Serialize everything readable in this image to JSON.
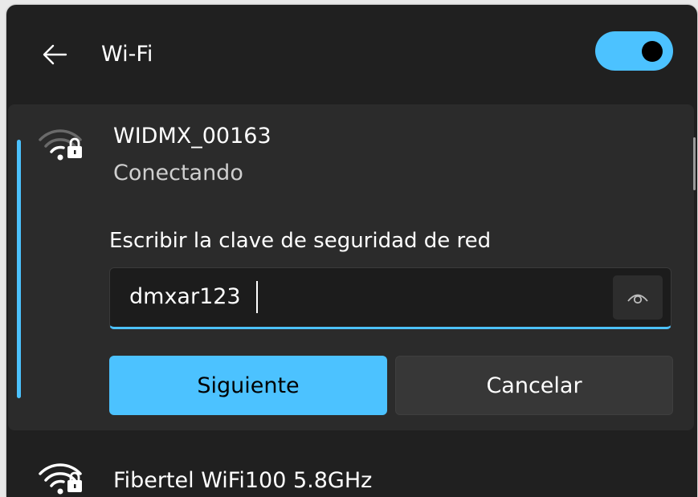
{
  "header": {
    "title": "Wi-Fi",
    "back_icon": "arrow-left-icon",
    "toggle_on": true
  },
  "selected_network": {
    "name": "WIDMX_00163",
    "status": "Conectando",
    "icon": "wifi-secured-icon",
    "password_prompt": "Escribir la clave de seguridad de red",
    "password_value": "dmxar123",
    "reveal_icon": "eye-icon",
    "next_label": "Siguiente",
    "cancel_label": "Cancelar"
  },
  "other_networks": [
    {
      "name": "Fibertel WiFi100 5.8GHz",
      "icon": "wifi-secured-icon"
    }
  ],
  "colors": {
    "accent": "#4cc2ff",
    "panel_bg": "#202020",
    "card_bg": "#2b2b2b"
  }
}
